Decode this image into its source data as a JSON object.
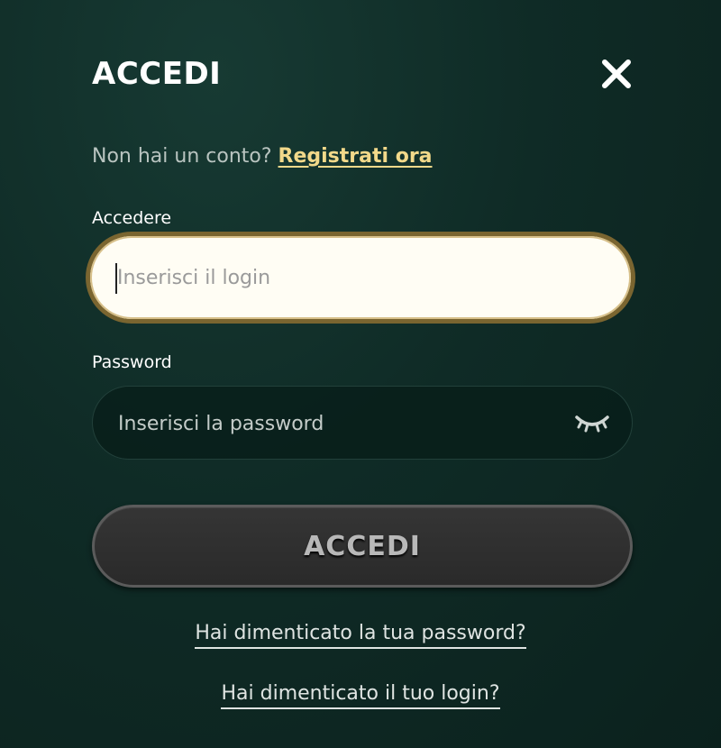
{
  "modal": {
    "title": "ACCEDI",
    "close_icon": "close-icon"
  },
  "signup": {
    "prompt": "Non hai un conto?",
    "link_label": "Registrati ora"
  },
  "login_field": {
    "label": "Accedere",
    "placeholder": "Inserisci il login",
    "value": ""
  },
  "password_field": {
    "label": "Password",
    "placeholder": "Inserisci la password",
    "value": "",
    "toggle_icon": "eye-closed-icon"
  },
  "submit": {
    "label": "ACCEDI"
  },
  "links": {
    "forgot_password": "Hai dimenticato la tua password?",
    "forgot_login": "Hai dimenticato il tuo login?"
  },
  "colors": {
    "background": "#0f2b26",
    "accent_link": "#f2d98a",
    "focus_border": "#7a6530",
    "button_bg": "#2f2f2f"
  }
}
